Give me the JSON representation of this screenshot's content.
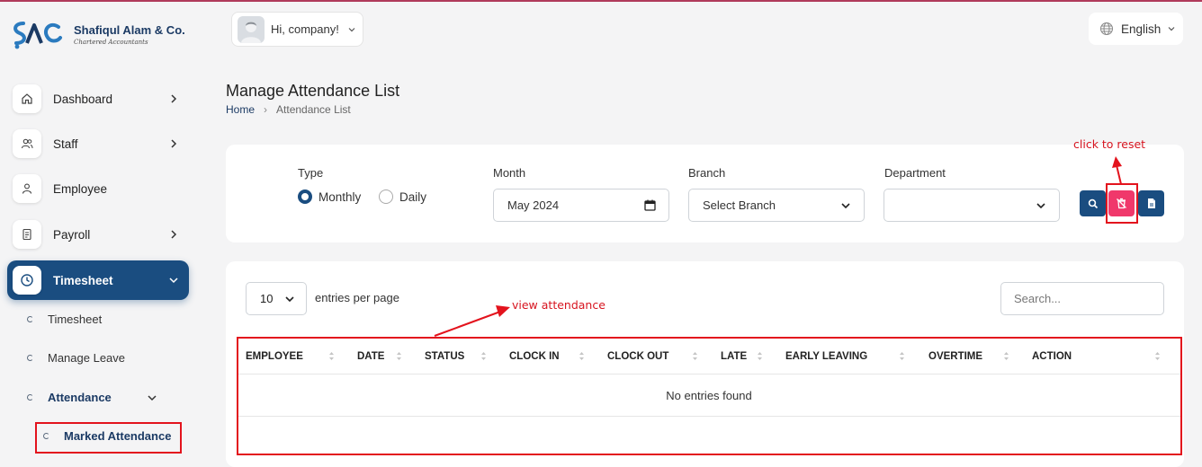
{
  "brand": {
    "name": "Shafiqul Alam & Co.",
    "subtitle": "Chartered Accountants"
  },
  "header": {
    "greeting": "Hi, company!",
    "language": "English"
  },
  "sidebar": {
    "items": [
      {
        "label": "Dashboard",
        "icon": "home-icon"
      },
      {
        "label": "Staff",
        "icon": "users-icon"
      },
      {
        "label": "Employee",
        "icon": "user-icon"
      },
      {
        "label": "Payroll",
        "icon": "receipt-icon"
      },
      {
        "label": "Timesheet",
        "icon": "clock-icon"
      }
    ],
    "sub_items": [
      {
        "label": "Timesheet"
      },
      {
        "label": "Manage Leave"
      },
      {
        "label": "Attendance"
      },
      {
        "label": "Marked Attendance"
      }
    ]
  },
  "page": {
    "title": "Manage Attendance List",
    "breadcrumb": {
      "home": "Home",
      "current": "Attendance List"
    }
  },
  "filters": {
    "type_label": "Type",
    "type_options": [
      "Monthly",
      "Daily"
    ],
    "type_selected": "Monthly",
    "month_label": "Month",
    "month_value": "May 2024",
    "branch_label": "Branch",
    "branch_value": "Select Branch",
    "department_label": "Department",
    "department_value": ""
  },
  "table": {
    "entries_value": "10",
    "entries_text": "entries per page",
    "search_placeholder": "Search...",
    "columns": [
      "EMPLOYEE",
      "DATE",
      "STATUS",
      "CLOCK IN",
      "CLOCK OUT",
      "LATE",
      "EARLY LEAVING",
      "OVERTIME",
      "ACTION"
    ],
    "empty_text": "No entries found"
  },
  "annotations": {
    "reset_note": "click to reset",
    "view_note": "view attendance"
  },
  "colors": {
    "primary": "#1a4d80",
    "reset_button": "#f0386b",
    "annotation_red": "#e3131d"
  }
}
